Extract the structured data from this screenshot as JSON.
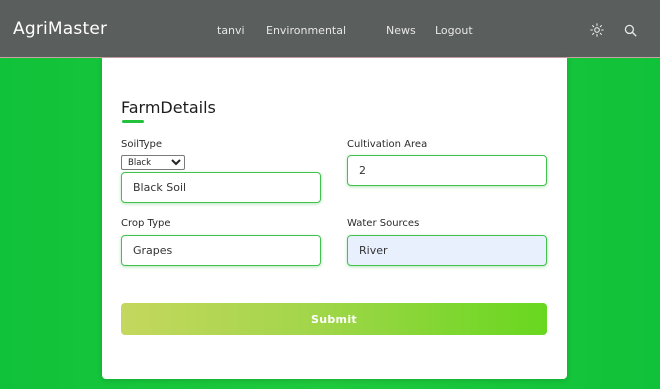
{
  "navbar": {
    "brand": "AgriMaster",
    "links": [
      "tanvi",
      "Environmental",
      "News",
      "Logout"
    ],
    "icons": [
      "sun-icon",
      "search-icon"
    ]
  },
  "form": {
    "title": "FarmDetails",
    "soil_type": {
      "label": "SoilType",
      "selected": "Black",
      "value": "Black Soil"
    },
    "cultivation_area": {
      "label": "Cultivation Area",
      "value": "2"
    },
    "crop_type": {
      "label": "Crop Type",
      "value": "Grapes"
    },
    "water_sources": {
      "label": "Water Sources",
      "value": "River"
    },
    "submit_label": "Submit"
  },
  "colors": {
    "navbar": "#5a5e5c",
    "background": "#1fc93c",
    "accent": "#22c23d",
    "submit_start": "#c4d75e",
    "submit_end": "#68d71f"
  }
}
